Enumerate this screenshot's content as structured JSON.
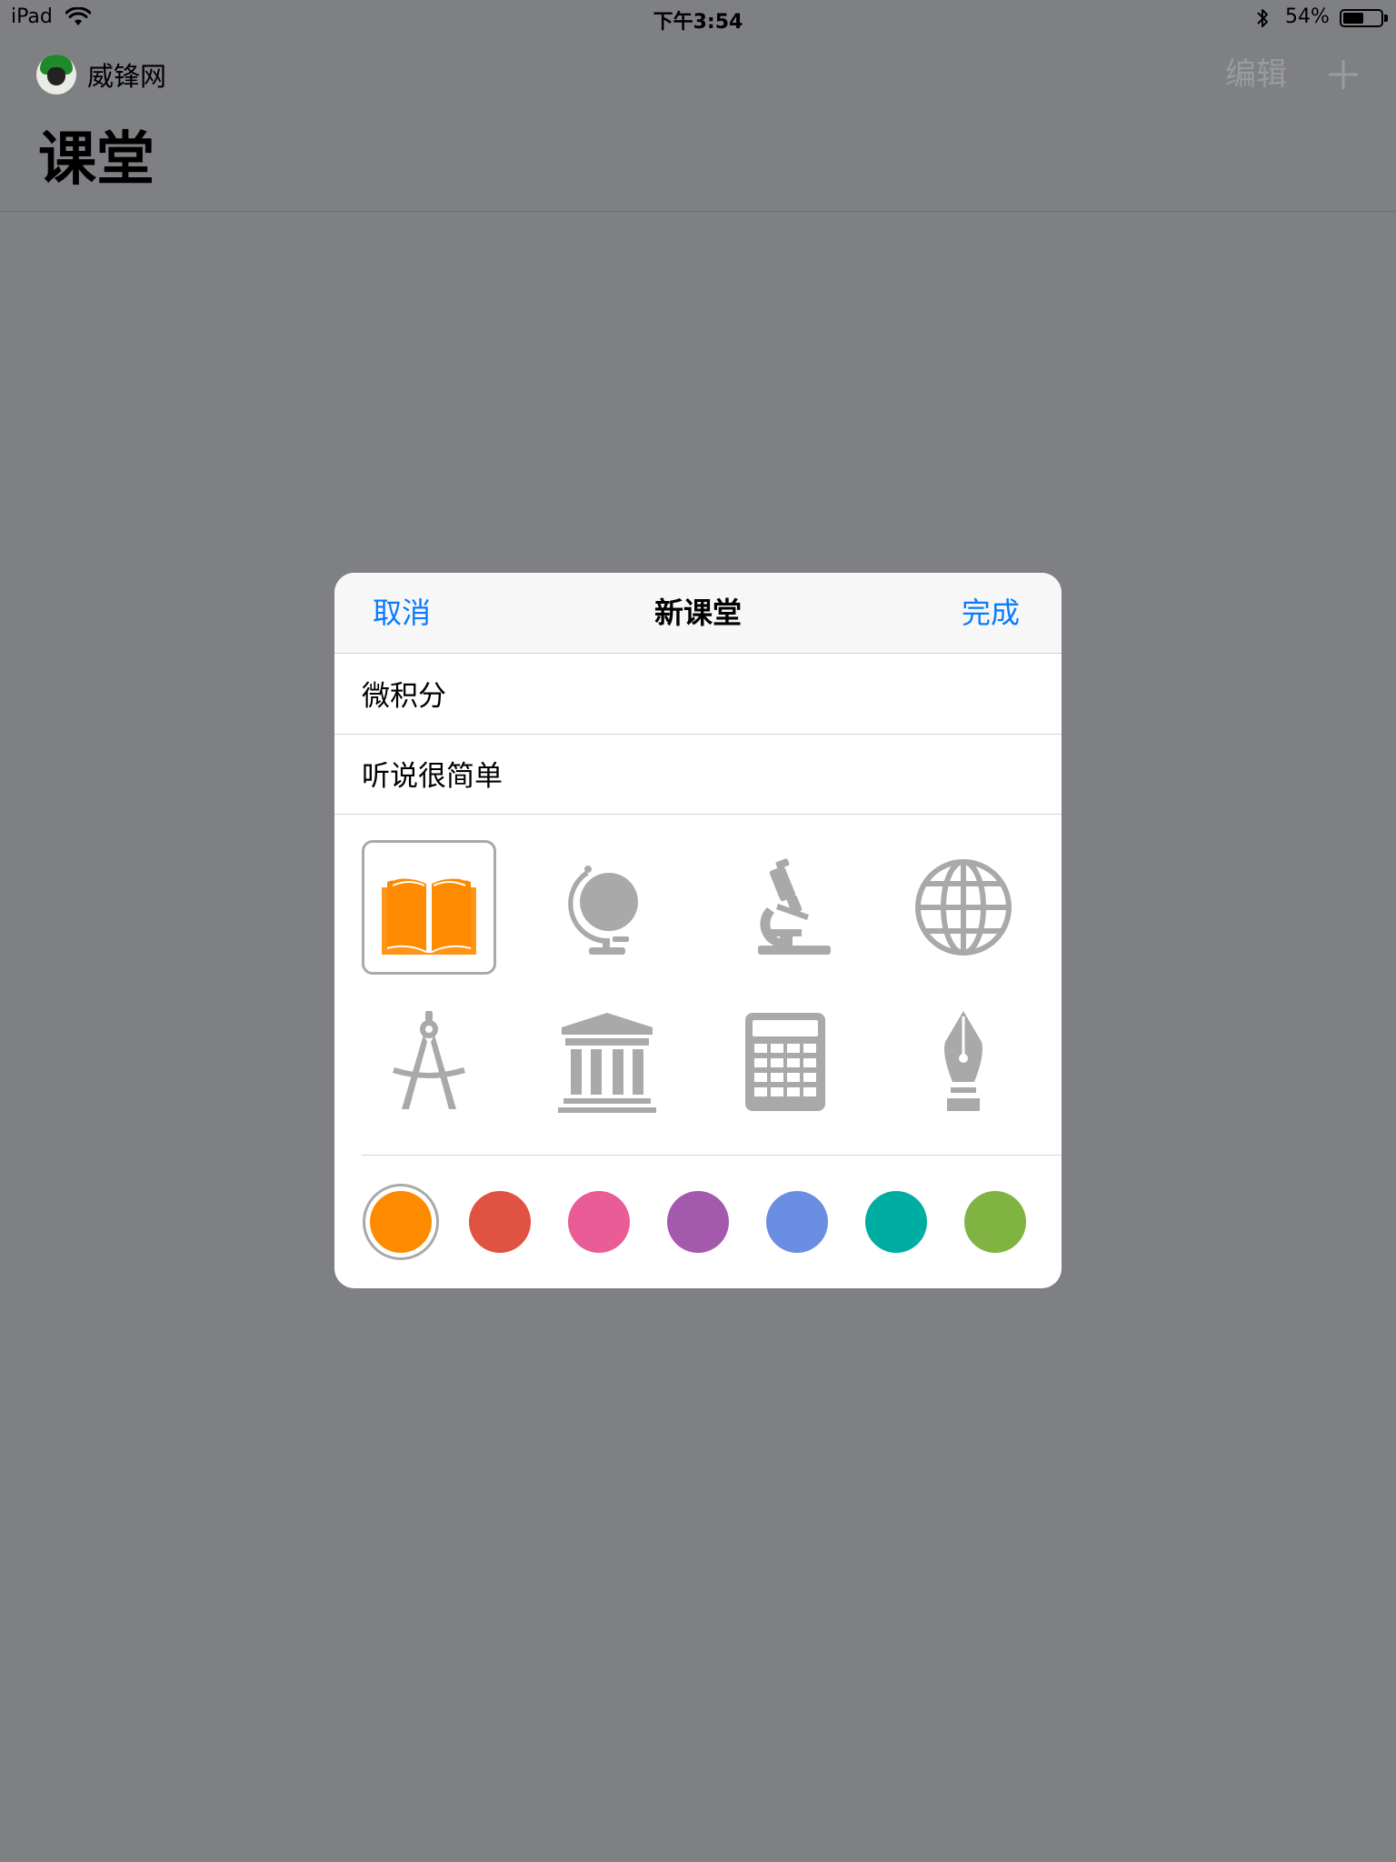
{
  "status_bar": {
    "device": "iPad",
    "time": "下午3:54",
    "battery_text": "54%",
    "battery_level": 0.54
  },
  "nav": {
    "back_label": "威锋网",
    "edit_label": "编辑",
    "title": "课堂"
  },
  "dialog": {
    "cancel_label": "取消",
    "title": "新课堂",
    "done_label": "完成",
    "course_name": "微积分",
    "course_description": "听说很简单",
    "icons": [
      {
        "name": "book-icon",
        "selected": true
      },
      {
        "name": "globe-icon",
        "selected": false
      },
      {
        "name": "microscope-icon",
        "selected": false
      },
      {
        "name": "world-icon",
        "selected": false
      },
      {
        "name": "compass-icon",
        "selected": false
      },
      {
        "name": "museum-icon",
        "selected": false
      },
      {
        "name": "calculator-icon",
        "selected": false
      },
      {
        "name": "pen-nib-icon",
        "selected": false
      }
    ],
    "selected_icon_color": "#fe8a00",
    "unselected_icon_color": "#a9a9a9",
    "colors": [
      {
        "name": "orange",
        "hex": "#fe8a00",
        "selected": true
      },
      {
        "name": "red",
        "hex": "#e05242"
      },
      {
        "name": "pink",
        "hex": "#e95c95"
      },
      {
        "name": "purple",
        "hex": "#a35aac"
      },
      {
        "name": "blue",
        "hex": "#698ee2"
      },
      {
        "name": "teal",
        "hex": "#00ada3"
      },
      {
        "name": "green",
        "hex": "#81b342"
      }
    ],
    "accent_color": "#0a7aff"
  }
}
